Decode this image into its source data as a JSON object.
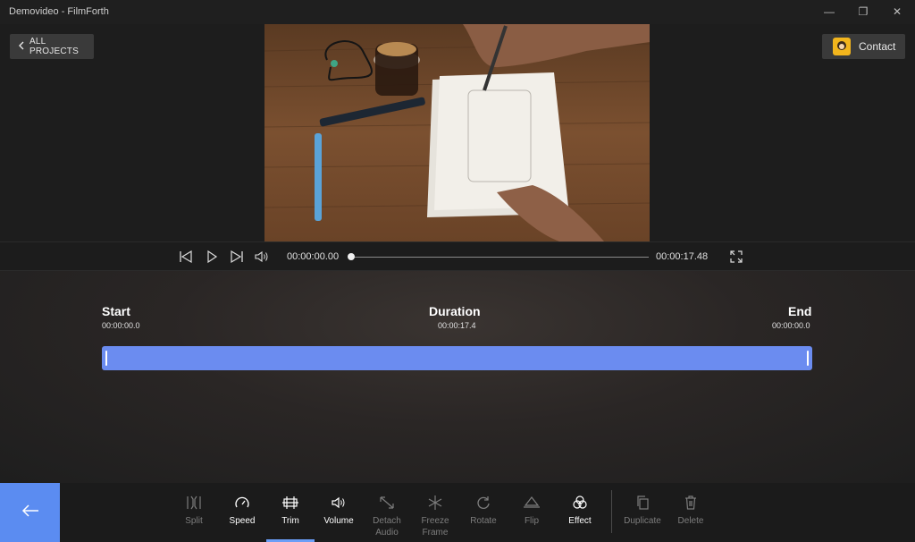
{
  "window": {
    "title": "Demovideo - FilmForth"
  },
  "header": {
    "all_projects_label": "ALL PROJECTS",
    "contact_label": "Contact"
  },
  "player": {
    "current_time": "00:00:00.00",
    "total_time": "00:00:17.48",
    "progress": 0
  },
  "trim": {
    "start_label": "Start",
    "start_value": "00:00:00.0",
    "duration_label": "Duration",
    "duration_value": "00:00:17.4",
    "end_label": "End",
    "end_value": "00:00:00.0",
    "bar_color": "#6b8cf0"
  },
  "toolbar": {
    "tools": [
      {
        "label": "Split",
        "enabled": false,
        "icon": "split-icon"
      },
      {
        "label": "Speed",
        "enabled": true,
        "icon": "speed-icon"
      },
      {
        "label": "Trim",
        "enabled": true,
        "icon": "trim-icon",
        "active": true
      },
      {
        "label": "Volume",
        "enabled": true,
        "icon": "volume-icon"
      },
      {
        "label": "Detach\nAudio",
        "enabled": false,
        "icon": "detach-audio-icon"
      },
      {
        "label": "Freeze\nFrame",
        "enabled": false,
        "icon": "snowflake-icon"
      },
      {
        "label": "Rotate",
        "enabled": false,
        "icon": "rotate-icon"
      },
      {
        "label": "Flip",
        "enabled": false,
        "icon": "flip-icon"
      },
      {
        "label": "Effect",
        "enabled": true,
        "icon": "effect-icon"
      },
      {
        "label": "Duplicate",
        "enabled": false,
        "icon": "duplicate-icon"
      },
      {
        "label": "Delete",
        "enabled": false,
        "icon": "trash-icon"
      }
    ]
  },
  "colors": {
    "accent": "#5b8cf1",
    "active_underline": "#6b9ef7",
    "contact_avatar": "#f2b51d"
  }
}
